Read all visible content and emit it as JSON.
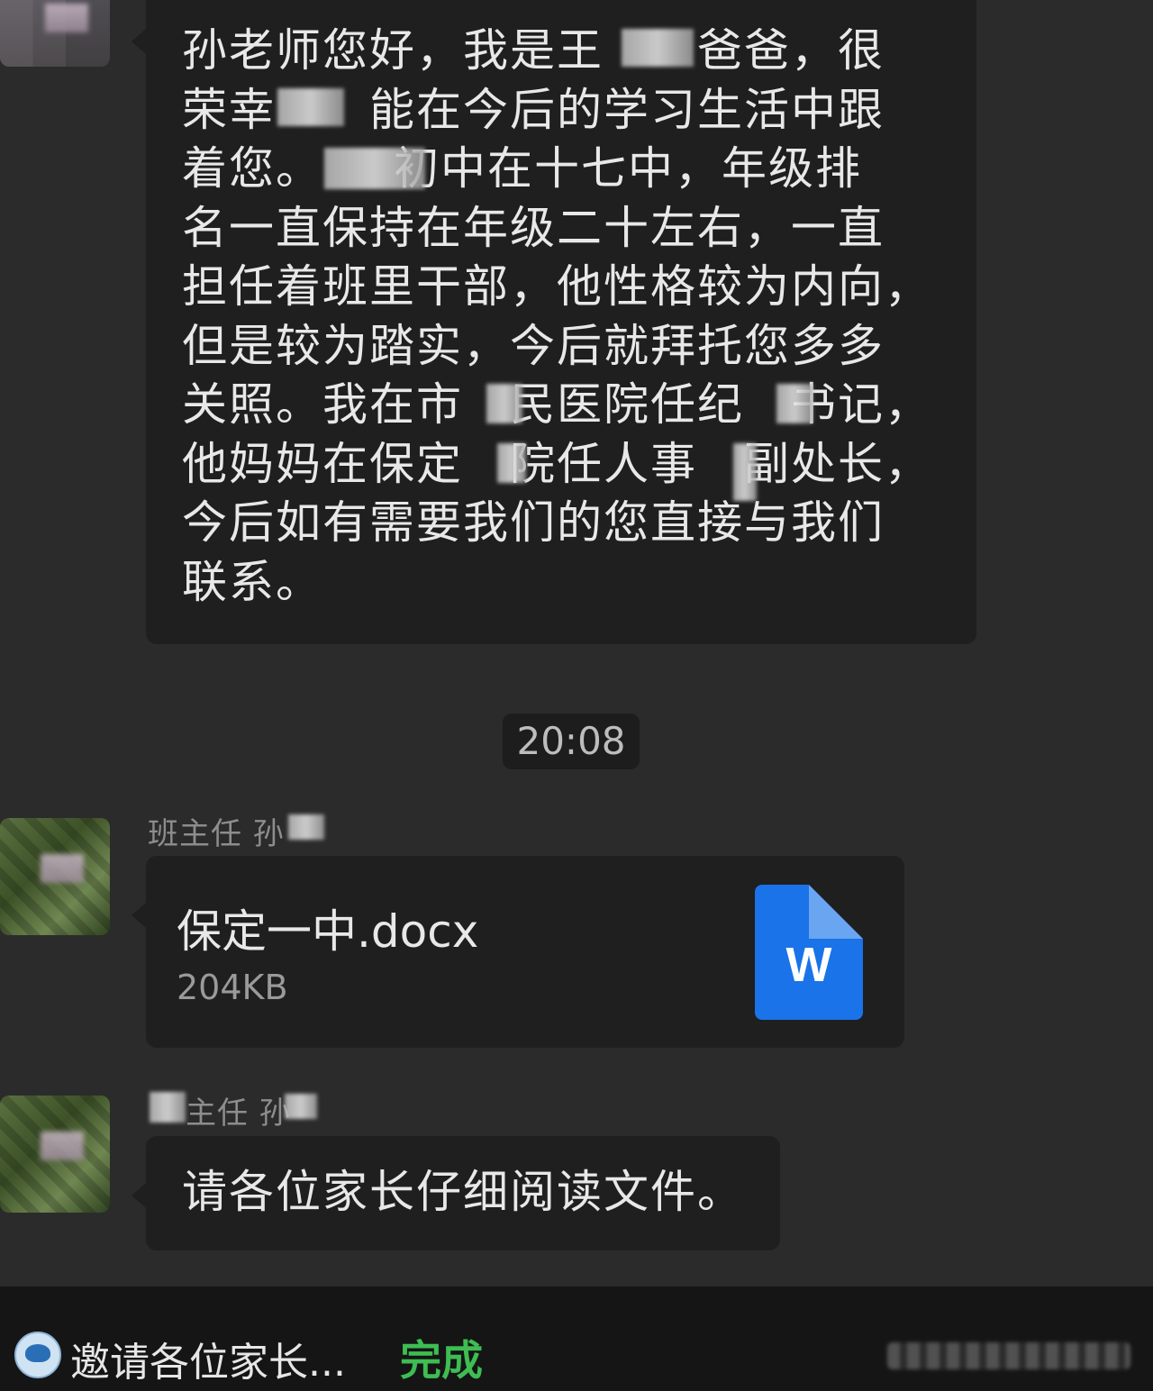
{
  "chat": {
    "message1": {
      "text": "孙老师您好，我是王　　爸爸，很\n荣幸　　能在今后的学习生活中跟\n着您。　　初中在十七中，年级排\n名一直保持在年级二十左右，一直\n担任着班里干部，他性格较为内向，\n但是较为踏实，今后就拜托您多多\n关照。我在市　民医院任纪　书记，\n他妈妈在保定　院任人事　副处长，\n今后如有需要我们的您直接与我们\n联系。"
    },
    "timestamp": "20:08",
    "message2": {
      "sender": "班主任 孙",
      "file_name": "保定一中.docx",
      "file_size": "204KB",
      "file_icon_letter": "W"
    },
    "message3": {
      "sender": "主任 孙",
      "text": "请各位家长仔细阅读文件。"
    }
  },
  "bottom_bar": {
    "text": "邀请各位家长...",
    "done_label": "完成"
  },
  "colors": {
    "background": "#2b2b2b",
    "bubble": "#1f1f1f",
    "word_blue": "#1a73e8",
    "done_green": "#3dbd52"
  }
}
